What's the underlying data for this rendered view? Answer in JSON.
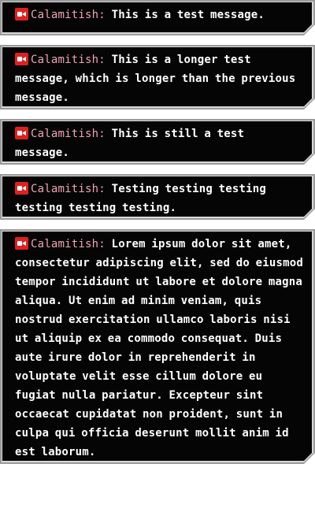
{
  "author_color": "#f0a4b6",
  "platform_icon": "video-camera-icon",
  "messages": [
    {
      "author": "Calamitish",
      "text": "This is a test message."
    },
    {
      "author": "Calamitish",
      "text": "This is a longer test message, which is longer than the previous message."
    },
    {
      "author": "Calamitish",
      "text": "This is still a test message."
    },
    {
      "author": "Calamitish",
      "text": "Testing testing testing testing testing testing."
    },
    {
      "author": "Calamitish",
      "text": "Lorem ipsum dolor sit amet, consectetur adipiscing elit, sed do eiusmod tempor incididunt ut labore et dolore magna aliqua. Ut enim ad minim veniam, quis nostrud exercitation ullamco laboris nisi ut aliquip ex ea commodo consequat. Duis aute irure dolor in reprehenderit in voluptate velit esse cillum dolore eu fugiat nulla pariatur. Excepteur sint occaecat cupidatat non proident, sunt in culpa qui officia deserunt mollit anim id est laborum."
    }
  ]
}
